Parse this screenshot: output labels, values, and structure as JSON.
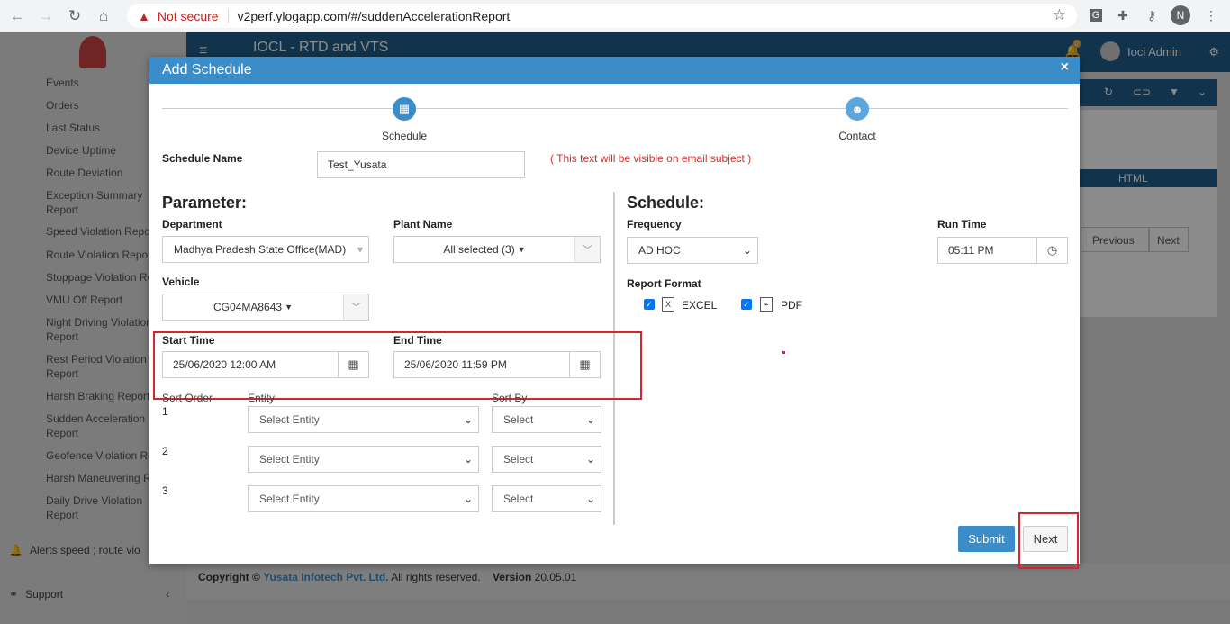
{
  "browser": {
    "security_label": "Not secure",
    "url": "v2perf.ylogapp.com/#/suddenAccelerationReport",
    "profile_initial": "N",
    "ext_g": "G"
  },
  "app": {
    "title": "IOCL - RTD and VTS",
    "user": "Ioci Admin",
    "notification_count": "0"
  },
  "sidebar": {
    "items": [
      "Events",
      "Orders",
      "Last Status",
      "Device Uptime",
      "Route Deviation",
      "Exception Summary Report",
      "Speed Violation Report",
      "Route Violation Report",
      "Stoppage Violation Report",
      "VMU Off Report",
      "Night Driving Violation Report",
      "Rest Period Violation Report",
      "Harsh Braking Report",
      "Sudden Acceleration Report",
      "Geofence Violation Report",
      "Harsh Maneuvering Report",
      "Daily Drive Violation Report"
    ],
    "alerts": "Alerts speed ; route vio",
    "support": "Support"
  },
  "background": {
    "html_col": "HTML",
    "previous": "Previous",
    "next": "Next"
  },
  "footer": {
    "copyright": "Copyright ©",
    "company": "Yusata Infotech Pvt. Ltd.",
    "rights": "All rights reserved.",
    "version_label": "Version",
    "version": "20.05.01"
  },
  "modal": {
    "title": "Add Schedule",
    "steps": [
      "Schedule",
      "Contact"
    ],
    "schedule_name_label": "Schedule Name",
    "schedule_name_value": "Test_Yusata",
    "schedule_name_hint": "( This text will be visible on email subject )",
    "parameter_title": "Parameter:",
    "department_label": "Department",
    "department_value": "Madhya Pradesh State Office(MAD)",
    "plant_label": "Plant Name",
    "plant_value": "All selected (3)",
    "vehicle_label": "Vehicle",
    "vehicle_value": "CG04MA8643",
    "start_time_label": "Start Time",
    "start_time_value": "25/06/2020 12:00 AM",
    "end_time_label": "End Time",
    "end_time_value": "25/06/2020 11:59 PM",
    "sort_order_label": "Sort Order",
    "entity_label": "Entity",
    "sort_by_label": "Sort By",
    "sort_rows": [
      {
        "order": "1",
        "entity": "Select Entity",
        "sort_by": "Select"
      },
      {
        "order": "2",
        "entity": "Select Entity",
        "sort_by": "Select"
      },
      {
        "order": "3",
        "entity": "Select Entity",
        "sort_by": "Select"
      }
    ],
    "schedule_title": "Schedule:",
    "frequency_label": "Frequency",
    "frequency_value": "AD HOC",
    "run_time_label": "Run Time",
    "run_time_value": "05:11 PM",
    "report_format_label": "Report Format",
    "formats": [
      "EXCEL",
      "PDF"
    ],
    "submit": "Submit",
    "next": "Next"
  },
  "colors": {
    "header_blue": "#3a8dc9",
    "topbar_blue": "#1f5f8b",
    "highlight_red": "#d9232d"
  }
}
